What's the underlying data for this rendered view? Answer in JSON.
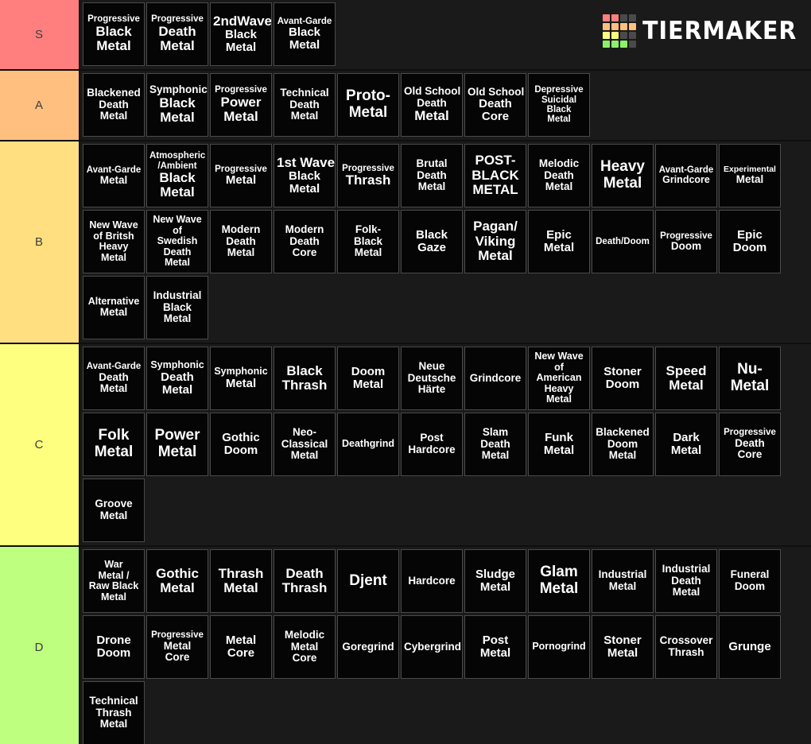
{
  "brand": {
    "name": "TIERMAKER",
    "logo_colors": [
      "#ff7f7f",
      "#ff7f7f",
      "#4a4a4a",
      "#4a4a4a",
      "#ffbf7f",
      "#ffbf7f",
      "#ffbf7f",
      "#ffbf7f",
      "#ffff7f",
      "#ffff7f",
      "#4a4a4a",
      "#4a4a4a",
      "#8cf06a",
      "#8cf06a",
      "#8cf06a",
      "#4a4a4a"
    ]
  },
  "tiers": [
    {
      "label": "S",
      "color": "#FF7F7F",
      "items": [
        {
          "lines": [
            "Progressive",
            "Black",
            "Metal"
          ],
          "sizes": [
            "fs-11",
            "fs-17",
            "fs-17"
          ]
        },
        {
          "lines": [
            "Progressive",
            "Death",
            "Metal"
          ],
          "sizes": [
            "fs-11",
            "fs-17",
            "fs-17"
          ]
        },
        {
          "lines": [
            "2ndWave",
            "Black",
            "Metal"
          ],
          "sizes": [
            "fs-17",
            "fs-15",
            "fs-15"
          ]
        },
        {
          "lines": [
            "Avant-Garde",
            "Black",
            "Metal"
          ],
          "sizes": [
            "fs-11",
            "fs-15",
            "fs-15"
          ]
        }
      ]
    },
    {
      "label": "A",
      "color": "#FFBF7F",
      "items": [
        {
          "lines": [
            "Blackened",
            "Death",
            "Metal"
          ],
          "sizes": [
            "fs-13",
            "fs-13",
            "fs-13"
          ]
        },
        {
          "lines": [
            "Symphonic",
            "Black",
            "Metal"
          ],
          "sizes": [
            "fs-13",
            "fs-17",
            "fs-17"
          ]
        },
        {
          "lines": [
            "Progressive",
            "Power",
            "Metal"
          ],
          "sizes": [
            "fs-11",
            "fs-17",
            "fs-17"
          ]
        },
        {
          "lines": [
            "Technical",
            "Death",
            "Metal"
          ],
          "sizes": [
            "fs-13",
            "fs-13",
            "fs-13"
          ]
        },
        {
          "lines": [
            "Proto-",
            "Metal"
          ],
          "sizes": [
            "fs-19",
            "fs-19"
          ]
        },
        {
          "lines": [
            "Old School",
            "Death",
            "Metal"
          ],
          "sizes": [
            "fs-13",
            "fs-13",
            "fs-17"
          ]
        },
        {
          "lines": [
            "Old School",
            "Death",
            "Core"
          ],
          "sizes": [
            "fs-13",
            "fs-15",
            "fs-15"
          ]
        },
        {
          "lines": [
            "Depressive",
            "Suicidal",
            "Black",
            "Metal"
          ],
          "sizes": [
            "fs-11",
            "fs-11",
            "fs-11",
            "fs-11"
          ]
        }
      ]
    },
    {
      "label": "B",
      "color": "#FFDF7F",
      "items": [
        {
          "lines": [
            "Avant-Garde",
            "Metal"
          ],
          "sizes": [
            "fs-11",
            "fs-13"
          ]
        },
        {
          "lines": [
            "Atmospheric",
            "/Ambient",
            "Black",
            "Metal"
          ],
          "sizes": [
            "fs-11",
            "fs-11",
            "fs-17",
            "fs-17"
          ]
        },
        {
          "lines": [
            "Progressive",
            "Metal"
          ],
          "sizes": [
            "fs-11",
            "fs-15"
          ]
        },
        {
          "lines": [
            "1st Wave",
            "Black",
            "Metal"
          ],
          "sizes": [
            "fs-17",
            "fs-15",
            "fs-15"
          ]
        },
        {
          "lines": [
            "Progressive",
            "Thrash"
          ],
          "sizes": [
            "fs-11",
            "fs-17"
          ]
        },
        {
          "lines": [
            "Brutal",
            "Death",
            "Metal"
          ],
          "sizes": [
            "fs-13",
            "fs-13",
            "fs-13"
          ]
        },
        {
          "lines": [
            "POST-",
            "BLACK",
            "METAL"
          ],
          "sizes": [
            "fs-17",
            "fs-17",
            "fs-17"
          ]
        },
        {
          "lines": [
            "Melodic",
            "Death",
            "Metal"
          ],
          "sizes": [
            "fs-13",
            "fs-13",
            "fs-13"
          ]
        },
        {
          "lines": [
            "Heavy",
            "Metal"
          ],
          "sizes": [
            "fs-19",
            "fs-19"
          ]
        },
        {
          "lines": [
            "Avant-Garde",
            "Grindcore"
          ],
          "sizes": [
            "fs-11",
            "fs-12"
          ]
        },
        {
          "lines": [
            "Experimental",
            "Metal"
          ],
          "sizes": [
            "fs-10",
            "fs-13"
          ]
        },
        {
          "lines": [
            "New Wave",
            "of Britsh",
            "Heavy",
            "Metal"
          ],
          "sizes": [
            "fs-12",
            "fs-12",
            "fs-12",
            "fs-12"
          ]
        },
        {
          "lines": [
            "New Wave",
            "of",
            "Swedish",
            "Death",
            "Metal"
          ],
          "sizes": [
            "fs-12",
            "fs-12",
            "fs-12",
            "fs-12",
            "fs-12"
          ]
        },
        {
          "lines": [
            "Modern",
            "Death",
            "Metal"
          ],
          "sizes": [
            "fs-13",
            "fs-13",
            "fs-13"
          ]
        },
        {
          "lines": [
            "Modern",
            "Death",
            "Core"
          ],
          "sizes": [
            "fs-13",
            "fs-13",
            "fs-13"
          ]
        },
        {
          "lines": [
            "Folk-",
            "Black",
            "Metal"
          ],
          "sizes": [
            "fs-13",
            "fs-13",
            "fs-13"
          ]
        },
        {
          "lines": [
            "Black",
            "Gaze"
          ],
          "sizes": [
            "fs-15",
            "fs-15"
          ]
        },
        {
          "lines": [
            "Pagan/",
            "Viking",
            "Metal"
          ],
          "sizes": [
            "fs-17",
            "fs-17",
            "fs-17"
          ]
        },
        {
          "lines": [
            "Epic",
            "Metal"
          ],
          "sizes": [
            "fs-15",
            "fs-15"
          ]
        },
        {
          "lines": [
            "Death/Doom"
          ],
          "sizes": [
            "fs-11"
          ]
        },
        {
          "lines": [
            "Progressive",
            "Doom"
          ],
          "sizes": [
            "fs-11",
            "fs-13"
          ]
        },
        {
          "lines": [
            "Epic",
            "Doom"
          ],
          "sizes": [
            "fs-15",
            "fs-15"
          ]
        },
        {
          "lines": [
            "Alternative",
            "Metal"
          ],
          "sizes": [
            "fs-12",
            "fs-13"
          ]
        },
        {
          "lines": [
            "Industrial",
            "Black",
            "Metal"
          ],
          "sizes": [
            "fs-13",
            "fs-13",
            "fs-13"
          ]
        }
      ]
    },
    {
      "label": "C",
      "color": "#FFFF7F",
      "items": [
        {
          "lines": [
            "Avant-Garde",
            "Death",
            "Metal"
          ],
          "sizes": [
            "fs-11",
            "fs-13",
            "fs-13"
          ]
        },
        {
          "lines": [
            "Symphonic",
            "Death",
            "Metal"
          ],
          "sizes": [
            "fs-12",
            "fs-15",
            "fs-15"
          ]
        },
        {
          "lines": [
            "Symphonic",
            "Metal"
          ],
          "sizes": [
            "fs-12",
            "fs-15"
          ]
        },
        {
          "lines": [
            "Black",
            "Thrash"
          ],
          "sizes": [
            "fs-17",
            "fs-17"
          ]
        },
        {
          "lines": [
            "Doom",
            "Metal"
          ],
          "sizes": [
            "fs-15",
            "fs-15"
          ]
        },
        {
          "lines": [
            "Neue",
            "Deutsche",
            "Härte"
          ],
          "sizes": [
            "fs-13",
            "fs-13",
            "fs-13"
          ]
        },
        {
          "lines": [
            "Grindcore"
          ],
          "sizes": [
            "fs-13"
          ]
        },
        {
          "lines": [
            "New Wave",
            "of",
            "American",
            "Heavy",
            "Metal"
          ],
          "sizes": [
            "fs-12",
            "fs-12",
            "fs-12",
            "fs-12",
            "fs-12"
          ]
        },
        {
          "lines": [
            "Stoner",
            "Doom"
          ],
          "sizes": [
            "fs-15",
            "fs-15"
          ]
        },
        {
          "lines": [
            "Speed",
            "Metal"
          ],
          "sizes": [
            "fs-17",
            "fs-17"
          ]
        },
        {
          "lines": [
            "Nu-",
            "Metal"
          ],
          "sizes": [
            "fs-19",
            "fs-19"
          ]
        },
        {
          "lines": [
            "Folk",
            "Metal"
          ],
          "sizes": [
            "fs-19",
            "fs-19"
          ]
        },
        {
          "lines": [
            "Power",
            "Metal"
          ],
          "sizes": [
            "fs-19",
            "fs-19"
          ]
        },
        {
          "lines": [
            "Gothic",
            "Doom"
          ],
          "sizes": [
            "fs-15",
            "fs-15"
          ]
        },
        {
          "lines": [
            "Neo-",
            "Classical",
            "Metal"
          ],
          "sizes": [
            "fs-13",
            "fs-13",
            "fs-13"
          ]
        },
        {
          "lines": [
            "Deathgrind"
          ],
          "sizes": [
            "fs-12"
          ]
        },
        {
          "lines": [
            "Post",
            "Hardcore"
          ],
          "sizes": [
            "fs-13",
            "fs-13"
          ]
        },
        {
          "lines": [
            "Slam",
            "Death",
            "Metal"
          ],
          "sizes": [
            "fs-13",
            "fs-13",
            "fs-13"
          ]
        },
        {
          "lines": [
            "Funk",
            "Metal"
          ],
          "sizes": [
            "fs-15",
            "fs-15"
          ]
        },
        {
          "lines": [
            "Blackened",
            "Doom",
            "Metal"
          ],
          "sizes": [
            "fs-13",
            "fs-13",
            "fs-13"
          ]
        },
        {
          "lines": [
            "Dark",
            "Metal"
          ],
          "sizes": [
            "fs-15",
            "fs-15"
          ]
        },
        {
          "lines": [
            "Progressive",
            "Death",
            "Core"
          ],
          "sizes": [
            "fs-11",
            "fs-13",
            "fs-13"
          ]
        },
        {
          "lines": [
            "Groove",
            "Metal"
          ],
          "sizes": [
            "fs-13",
            "fs-13"
          ]
        }
      ]
    },
    {
      "label": "D",
      "color": "#BFFF7F",
      "items": [
        {
          "lines": [
            "War",
            "Metal /",
            "Raw Black",
            "Metal"
          ],
          "sizes": [
            "fs-12",
            "fs-12",
            "fs-12",
            "fs-12"
          ]
        },
        {
          "lines": [
            "Gothic",
            "Metal"
          ],
          "sizes": [
            "fs-17",
            "fs-17"
          ]
        },
        {
          "lines": [
            "Thrash",
            "Metal"
          ],
          "sizes": [
            "fs-17",
            "fs-17"
          ]
        },
        {
          "lines": [
            "Death",
            "Thrash"
          ],
          "sizes": [
            "fs-17",
            "fs-17"
          ]
        },
        {
          "lines": [
            "Djent"
          ],
          "sizes": [
            "fs-19"
          ]
        },
        {
          "lines": [
            "Hardcore"
          ],
          "sizes": [
            "fs-13"
          ]
        },
        {
          "lines": [
            "Sludge",
            "Metal"
          ],
          "sizes": [
            "fs-15",
            "fs-15"
          ]
        },
        {
          "lines": [
            "Glam",
            "Metal"
          ],
          "sizes": [
            "fs-19",
            "fs-19"
          ]
        },
        {
          "lines": [
            "Industrial",
            "Metal"
          ],
          "sizes": [
            "fs-13",
            "fs-13"
          ]
        },
        {
          "lines": [
            "Industrial",
            "Death",
            "Metal"
          ],
          "sizes": [
            "fs-13",
            "fs-13",
            "fs-13"
          ]
        },
        {
          "lines": [
            "Funeral",
            "Doom"
          ],
          "sizes": [
            "fs-13",
            "fs-13"
          ]
        },
        {
          "lines": [
            "Drone",
            "Doom"
          ],
          "sizes": [
            "fs-15",
            "fs-15"
          ]
        },
        {
          "lines": [
            "Progressive",
            "Metal",
            "Core"
          ],
          "sizes": [
            "fs-11",
            "fs-13",
            "fs-13"
          ]
        },
        {
          "lines": [
            "Metal",
            "Core"
          ],
          "sizes": [
            "fs-15",
            "fs-15"
          ]
        },
        {
          "lines": [
            "Melodic",
            "Metal",
            "Core"
          ],
          "sizes": [
            "fs-13",
            "fs-13",
            "fs-13"
          ]
        },
        {
          "lines": [
            "Goregrind"
          ],
          "sizes": [
            "fs-13"
          ]
        },
        {
          "lines": [
            "Cybergrind"
          ],
          "sizes": [
            "fs-13"
          ]
        },
        {
          "lines": [
            "Post",
            "Metal"
          ],
          "sizes": [
            "fs-15",
            "fs-15"
          ]
        },
        {
          "lines": [
            "Pornogrind"
          ],
          "sizes": [
            "fs-12"
          ]
        },
        {
          "lines": [
            "Stoner",
            "Metal"
          ],
          "sizes": [
            "fs-15",
            "fs-15"
          ]
        },
        {
          "lines": [
            "Crossover",
            "Thrash"
          ],
          "sizes": [
            "fs-13",
            "fs-13"
          ]
        },
        {
          "lines": [
            "Grunge"
          ],
          "sizes": [
            "fs-15"
          ]
        },
        {
          "lines": [
            "Technical",
            "Thrash",
            "Metal"
          ],
          "sizes": [
            "fs-13",
            "fs-13",
            "fs-13"
          ]
        }
      ]
    }
  ]
}
